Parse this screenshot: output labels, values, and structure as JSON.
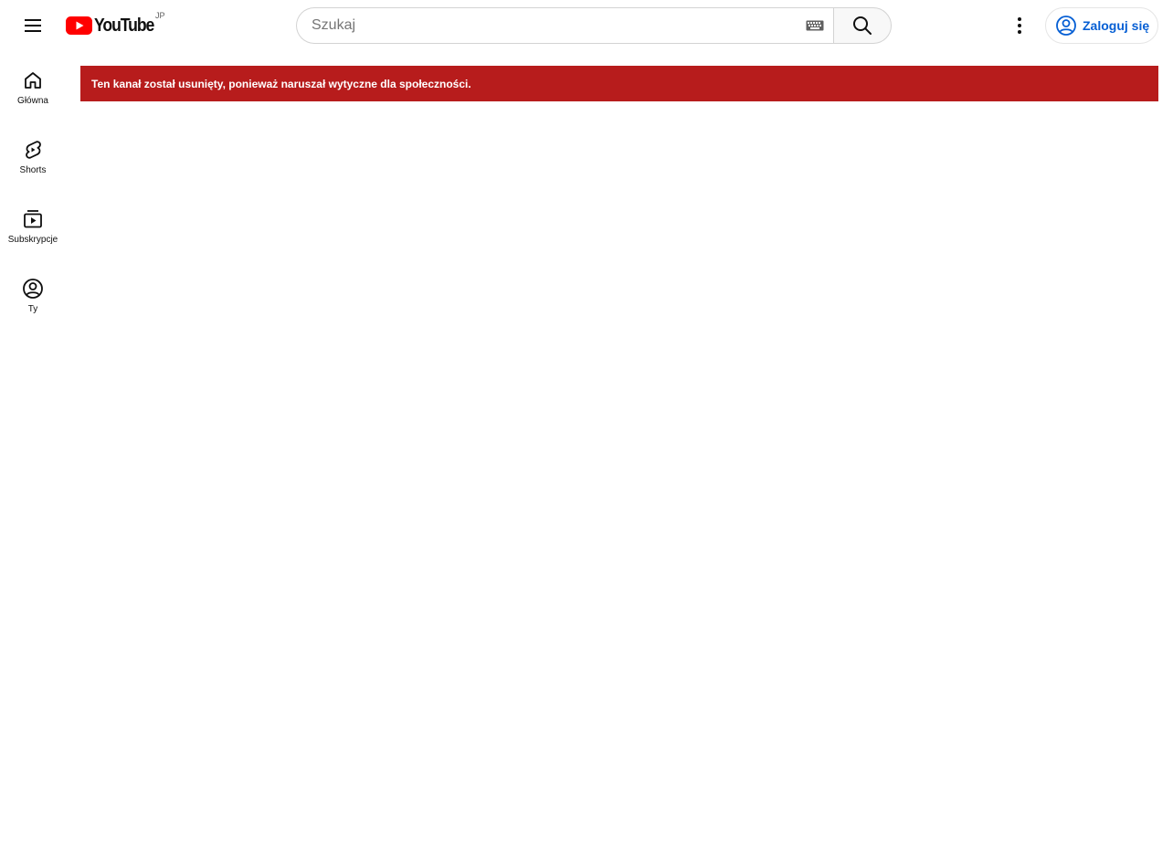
{
  "header": {
    "logo_text": "YouTube",
    "region_code": "JP",
    "search_placeholder": "Szukaj",
    "signin_label": "Zaloguj się"
  },
  "guide": {
    "items": [
      {
        "label": "Główna",
        "icon": "home-icon"
      },
      {
        "label": "Shorts",
        "icon": "shorts-icon"
      },
      {
        "label": "Subskrypcje",
        "icon": "subscriptions-icon"
      },
      {
        "label": "Ty",
        "icon": "you-icon"
      }
    ]
  },
  "alert": {
    "message": "Ten kanał został usunięty, ponieważ naruszał wytyczne dla społeczności."
  },
  "colors": {
    "brand_red": "#ff0000",
    "alert_background": "#b71c1c",
    "link_blue": "#065fd4"
  }
}
